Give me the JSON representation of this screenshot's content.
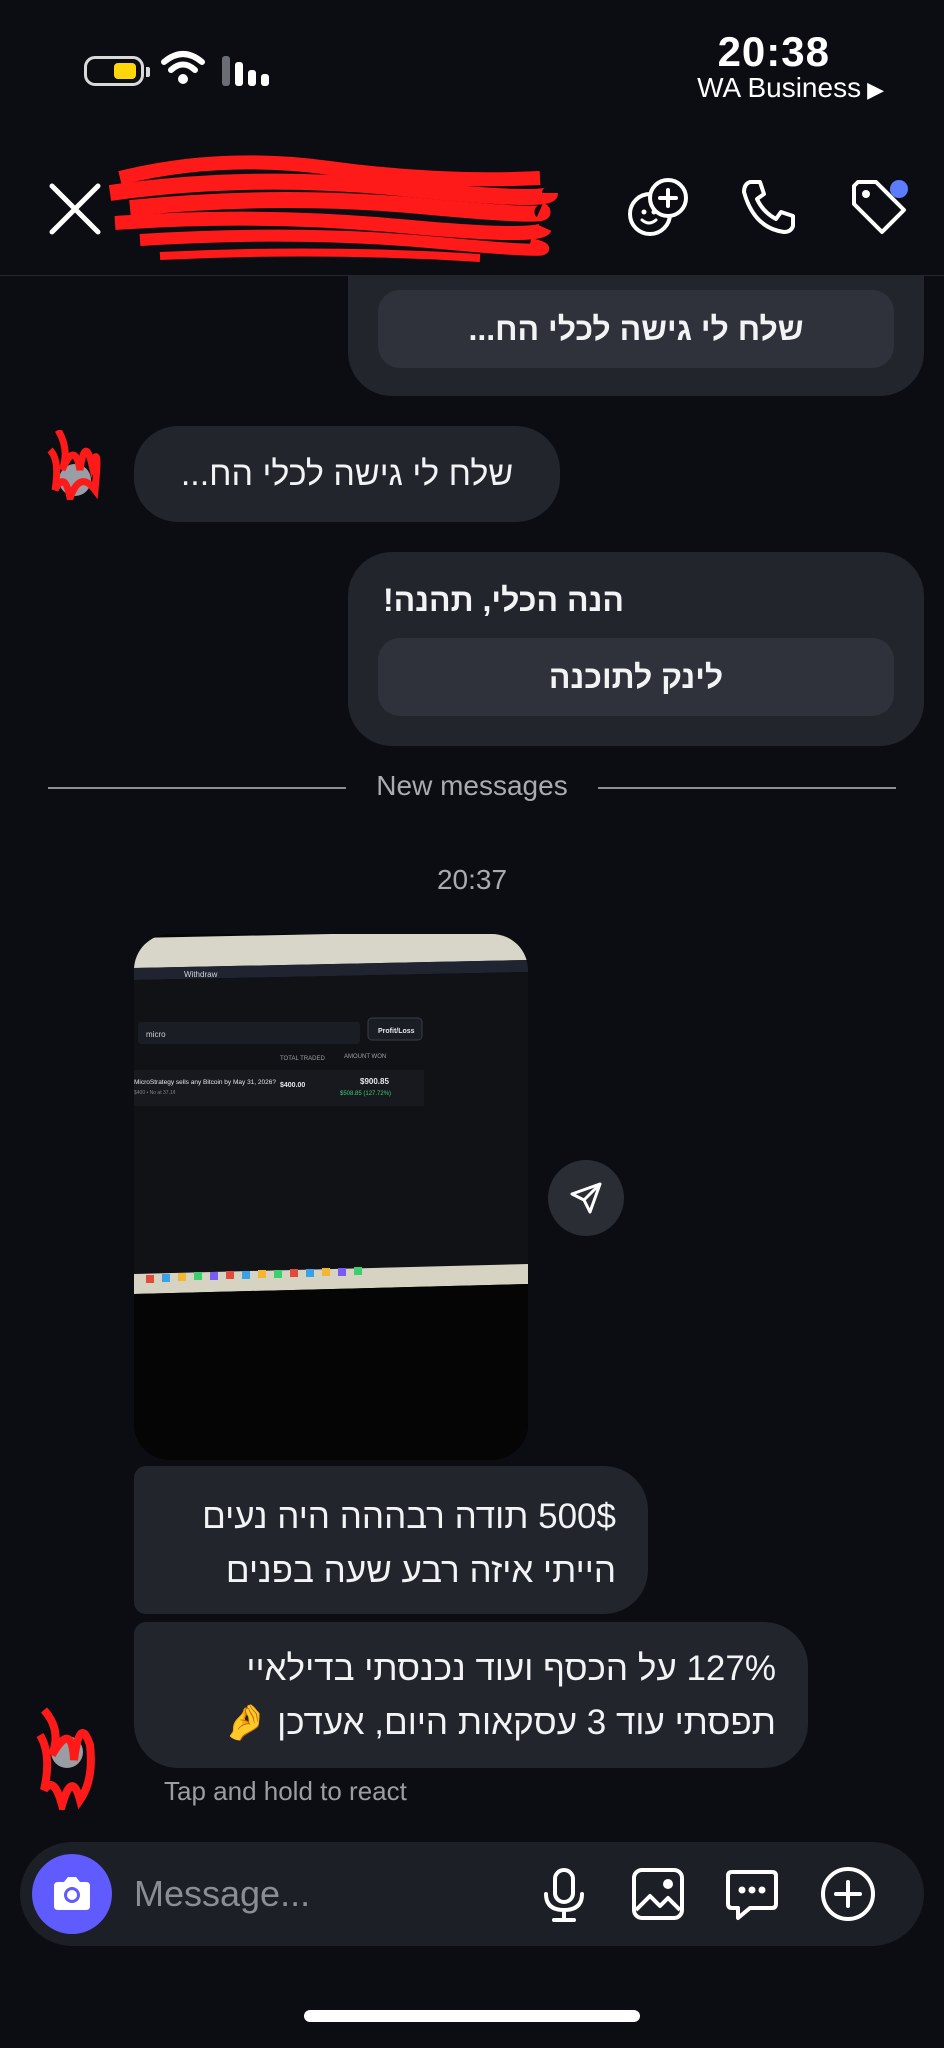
{
  "status_bar": {
    "time": "20:38",
    "back_app": "WA Business",
    "back_arrow": "▶"
  },
  "header": {
    "icons": [
      "close-icon",
      "group-emoji-icon",
      "phone-icon",
      "tag-icon"
    ],
    "accent_dot_color": "#5b7cff"
  },
  "messages": [
    {
      "side": "outgoing",
      "card_button": "שלח לי גישה לכלי הח..."
    },
    {
      "side": "incoming",
      "text": "שלח לי גישה לכלי הח..."
    },
    {
      "side": "outgoing",
      "title": "הנה הכלי, תהנה!",
      "card_button": "לינק לתוכנה"
    }
  ],
  "divider_label": "New messages",
  "timestamp": "20:37",
  "photo": {
    "withdraw": "Withdraw",
    "search": "micro",
    "profit_loss": "Profit/Loss",
    "col_total": "TOTAL TRADED",
    "col_amount": "AMOUNT WON",
    "row_title": "MicroStrategy sells any Bitcoin by May 31, 2026?",
    "row_sub": "$400 • No at 37.1¢",
    "row_total": "$400.00",
    "row_amount": "$900.85",
    "row_gain": "$508.85 (127.72%)"
  },
  "incoming_messages": [
    {
      "text": "500$ תודה רבההה היה נעים\nהייתי איזה רבע שעה בפנים"
    },
    {
      "text": "127% על הכסף ועוד נכנסתי בדילאיי\nתפסתי עוד 3 עסקאות היום, אעדכן 🤌"
    }
  ],
  "hint": "Tap and hold to react",
  "composer": {
    "placeholder": "Message...",
    "camera_color": "#5f5bff"
  }
}
